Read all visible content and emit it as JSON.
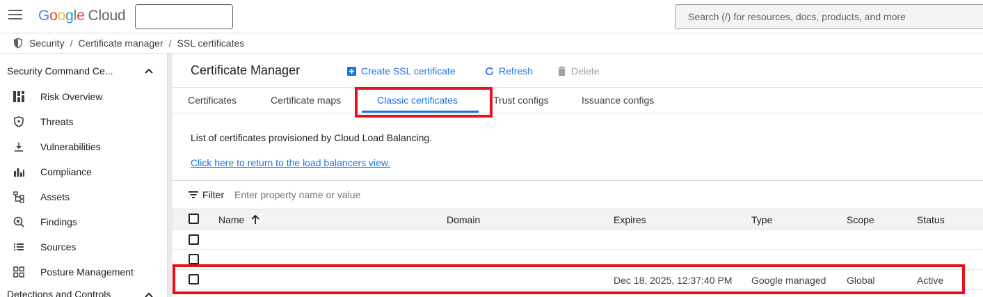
{
  "topbar": {
    "logo_google": [
      "G",
      "o",
      "o",
      "g",
      "l",
      "e"
    ],
    "logo_cloud": "Cloud",
    "search_placeholder": "Search (/) for resources, docs, products, and more"
  },
  "breadcrumb": [
    "Security",
    "Certificate manager",
    "SSL certificates"
  ],
  "sidebar": {
    "header": "Security Command Ce...",
    "items": [
      {
        "label": "Risk Overview",
        "icon": "dashboard-icon"
      },
      {
        "label": "Threats",
        "icon": "shield-icon"
      },
      {
        "label": "Vulnerabilities",
        "icon": "download-icon"
      },
      {
        "label": "Compliance",
        "icon": "bar-chart-icon"
      },
      {
        "label": "Assets",
        "icon": "hierarchy-icon"
      },
      {
        "label": "Findings",
        "icon": "search-settings-icon"
      },
      {
        "label": "Sources",
        "icon": "list-icon"
      },
      {
        "label": "Posture Management",
        "icon": "grid-icon"
      }
    ],
    "footer": "Detections and Controls"
  },
  "main": {
    "title": "Certificate Manager",
    "actions": {
      "create": "Create SSL certificate",
      "refresh": "Refresh",
      "delete": "Delete"
    },
    "tabs": [
      "Certificates",
      "Certificate maps",
      "Classic certificates",
      "Trust configs",
      "Issuance configs"
    ],
    "active_tab": "Classic certificates",
    "description": "List of certificates provisioned by Cloud Load Balancing.",
    "link": "Click here to return to the load balancers view.",
    "filter": {
      "label": "Filter",
      "placeholder": "Enter property name or value"
    },
    "table": {
      "columns": [
        "Name",
        "Domain",
        "Expires",
        "Type",
        "Scope",
        "Status"
      ],
      "rows": [
        {
          "name": "",
          "domain": "",
          "expires": "",
          "type": "",
          "scope": "",
          "status": ""
        },
        {
          "name": "",
          "domain": "",
          "expires": "",
          "type": "",
          "scope": "",
          "status": ""
        },
        {
          "name": "",
          "domain": "",
          "expires": "Dec 18, 2025, 12:37:40 PM",
          "type": "Google managed",
          "scope": "Global",
          "status": "Active"
        }
      ]
    }
  },
  "colors": {
    "accent": "#1a73e8",
    "highlight": "#e8111b"
  }
}
